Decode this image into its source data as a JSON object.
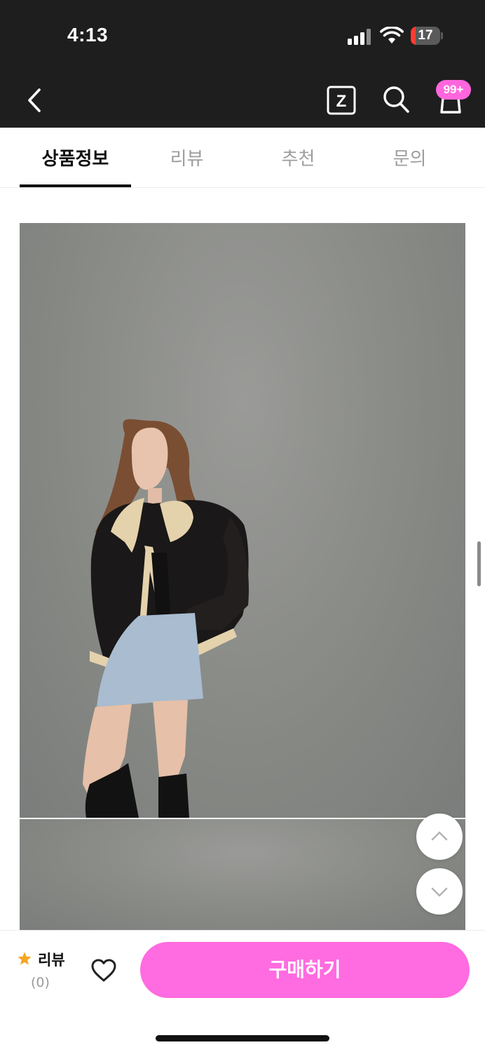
{
  "status_bar": {
    "time": "4:13",
    "battery_level": "17",
    "battery_fraction": 0.17
  },
  "nav": {
    "cart_badge": "99+",
    "z_icon_letter": "Z"
  },
  "tabs": [
    {
      "label": "상품정보",
      "active": true
    },
    {
      "label": "리뷰",
      "active": false
    },
    {
      "label": "추천",
      "active": false
    },
    {
      "label": "문의",
      "active": false
    }
  ],
  "bottom_bar": {
    "review_label": "리뷰",
    "review_count": "(0)",
    "buy_label": "구매하기"
  },
  "colors": {
    "accent_pink": "#ff6be0",
    "badge_pink": "#ff66dd",
    "star": "#f5a623",
    "header_bg": "#1e1e1e"
  },
  "icons": [
    "back-arrow-icon",
    "z-icon",
    "search-icon",
    "cart-icon",
    "star-icon",
    "heart-icon",
    "chevron-up-icon",
    "chevron-down-icon"
  ]
}
